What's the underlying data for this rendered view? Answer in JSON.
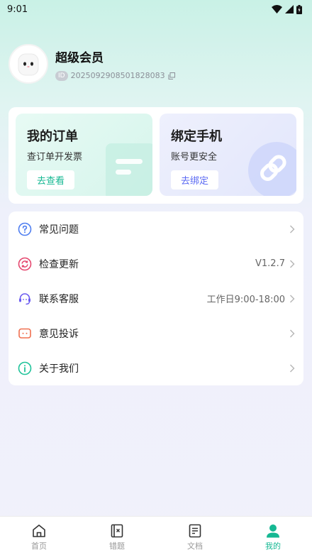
{
  "status_bar": {
    "time": "9:01"
  },
  "profile": {
    "title": "超级会员",
    "id_tag": "ID",
    "id_value": "2025092908501828083"
  },
  "cards": {
    "orders": {
      "title": "我的订单",
      "subtitle": "查订单开发票",
      "button": "去查看"
    },
    "bind": {
      "title": "绑定手机",
      "subtitle": "账号更安全",
      "button": "去绑定"
    }
  },
  "menu": [
    {
      "label": "常见问题",
      "value": "",
      "icon": "question-circle-icon",
      "color": "#4f7ef0"
    },
    {
      "label": "检查更新",
      "value": "V1.2.7",
      "icon": "refresh-icon",
      "color": "#e5486f"
    },
    {
      "label": "联系客服",
      "value": "工作日9:00-18:00",
      "icon": "headset-icon",
      "color": "#6b5bf0"
    },
    {
      "label": "意见投诉",
      "value": "",
      "icon": "feedback-chat-icon",
      "color": "#f07050"
    },
    {
      "label": "关于我们",
      "value": "",
      "icon": "info-circle-icon",
      "color": "#1fc39a"
    }
  ],
  "tabs": [
    {
      "label": "首页",
      "icon": "home-icon",
      "active": false
    },
    {
      "label": "错题",
      "icon": "wrong-book-icon",
      "active": false
    },
    {
      "label": "文档",
      "icon": "document-icon",
      "active": false
    },
    {
      "label": "我的",
      "icon": "user-icon",
      "active": true
    }
  ],
  "colors": {
    "accent": "#16b893",
    "indigo": "#5b6af3",
    "inactive_tab": "#999999"
  }
}
